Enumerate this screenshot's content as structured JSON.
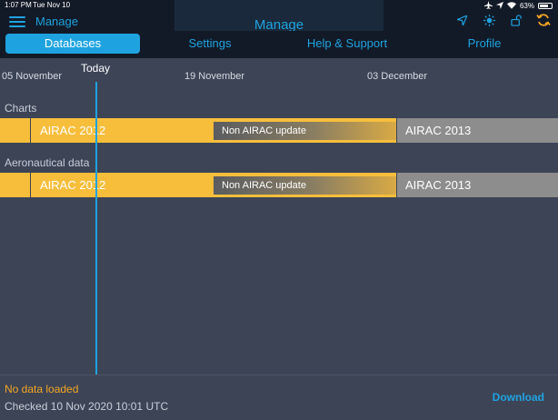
{
  "status_bar": {
    "time": "1:07 PM",
    "date": "Tue Nov 10",
    "battery": "63%"
  },
  "nav": {
    "menu_label": "Manage",
    "title": "Manage",
    "icons": [
      "location-arrow-icon",
      "brightness-icon",
      "lock-open-icon",
      "sync-icon"
    ]
  },
  "tabs": [
    {
      "label": "Databases",
      "active": true
    },
    {
      "label": "Settings",
      "active": false
    },
    {
      "label": "Help & Support",
      "active": false
    },
    {
      "label": "Profile",
      "active": false
    }
  ],
  "timeline": {
    "today_label": "Today",
    "dates": [
      "05 November",
      "19 November",
      "03 December"
    ],
    "sections": [
      {
        "title": "Charts",
        "current": "AIRAC 2012",
        "update": "Non AIRAC update",
        "next": "AIRAC 2013"
      },
      {
        "title": "Aeronautical data",
        "current": "AIRAC 2012",
        "update": "Non AIRAC update",
        "next": "AIRAC 2013"
      }
    ]
  },
  "footer": {
    "status": "No data loaded",
    "checked": "Checked 10 Nov 2020 10:01 UTC",
    "download": "Download"
  },
  "colors": {
    "accent": "#1fa3e0",
    "current_cycle": "#f7be3c",
    "next_cycle": "#8d8d8d",
    "warning": "#f5a623",
    "background": "#3c4456"
  }
}
